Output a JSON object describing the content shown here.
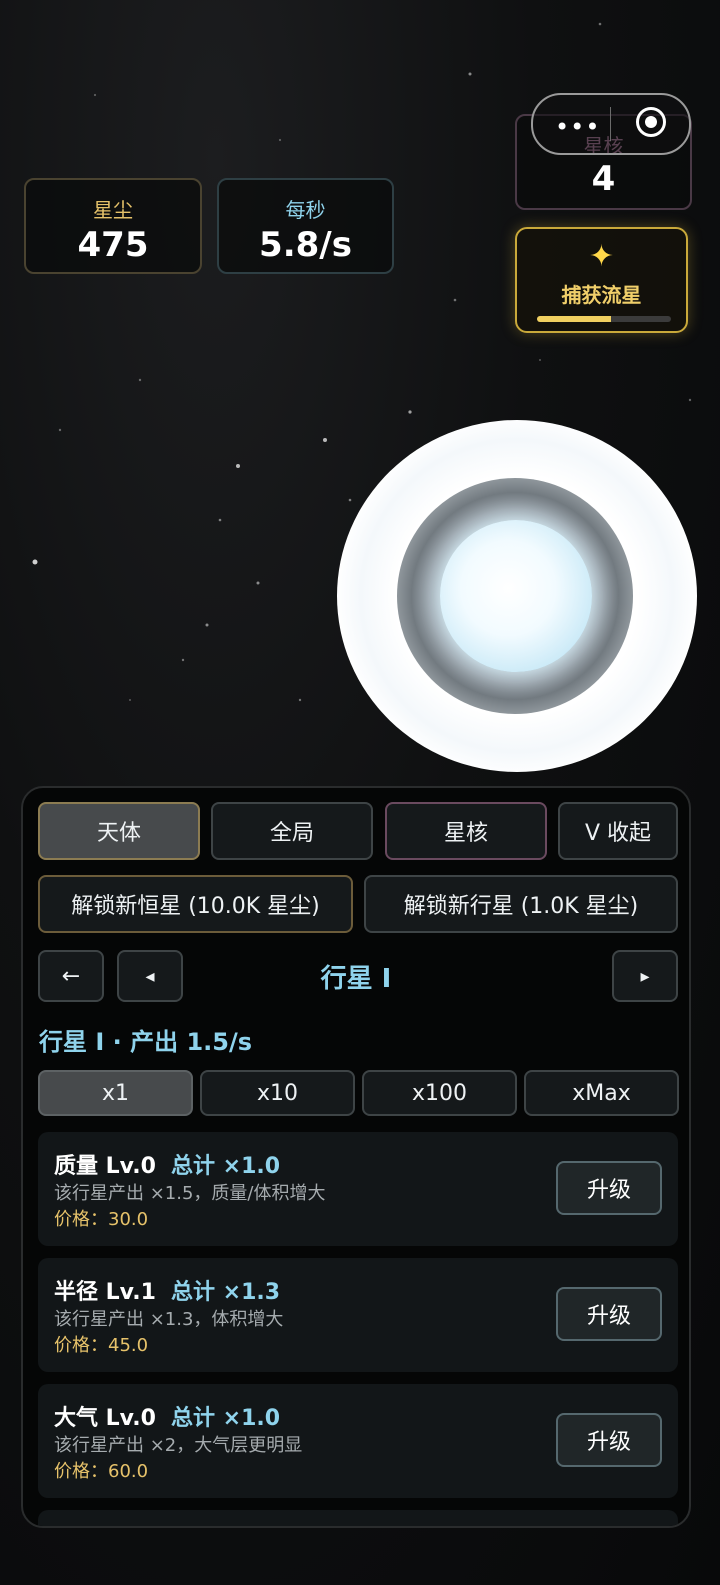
{
  "stats": {
    "stardust": {
      "label": "星尘",
      "value": "475"
    },
    "per_second": {
      "label": "每秒",
      "value": "5.8/s"
    },
    "star_core": {
      "label": "星核",
      "value": "4"
    }
  },
  "capsule": {
    "menu_icon": "more-dots-icon",
    "close_icon": "target-icon"
  },
  "meteor": {
    "label": "捕获流星",
    "icon": "sparkle-icon",
    "progress": 0.55,
    "color": "#f0d060"
  },
  "tabs": [
    "天体",
    "全局",
    "星核",
    "V 收起"
  ],
  "unlock": {
    "star": "解锁新恒星 (10.0K 星尘)",
    "planet": "解锁新行星 (1.0K 星尘)"
  },
  "nav": {
    "back": "←",
    "prev": "◂",
    "next": "▸",
    "title": "行星 I"
  },
  "subtitle": "行星 I · 产出 1.5/s",
  "multipliers": [
    "x1",
    "x10",
    "x100",
    "xMax"
  ],
  "upgrades": [
    {
      "name": "质量 Lv.0",
      "total": "总计 ×1.0",
      "desc": "该行星产出 ×1.5，质量/体积增大",
      "price": "价格：30.0",
      "button": "升级"
    },
    {
      "name": "半径 Lv.1",
      "total": "总计 ×1.3",
      "desc": "该行星产出 ×1.3，体积增大",
      "price": "价格：45.0",
      "button": "升级"
    },
    {
      "name": "大气 Lv.0",
      "total": "总计 ×1.0",
      "desc": "该行星产出 ×2，大气层更明显",
      "price": "价格：60.0",
      "button": "升级"
    }
  ],
  "colors": {
    "accent": "#8fd3ec",
    "gold": "#e6c26a",
    "core_pink": "#c58bb0"
  }
}
